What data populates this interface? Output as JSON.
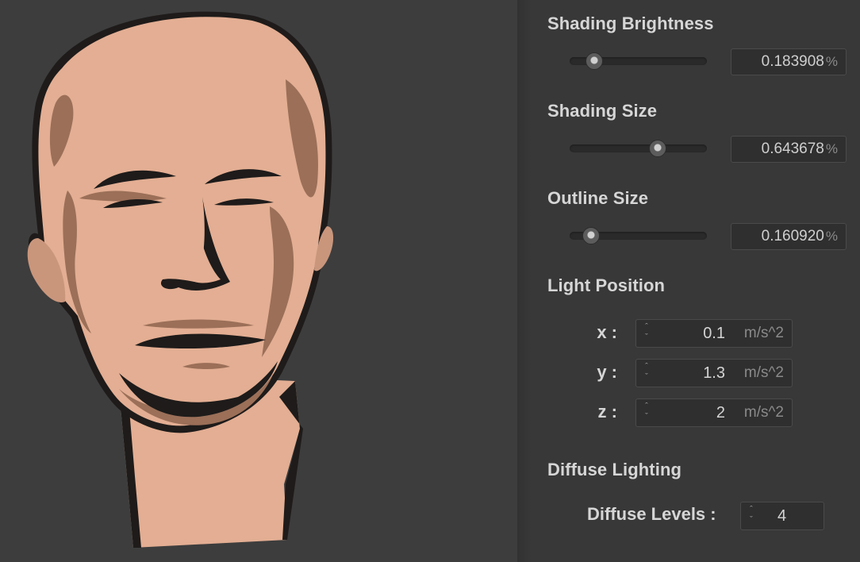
{
  "viewport": {
    "model": "head-sculpture",
    "colors": {
      "background": "#3d3d3d",
      "skin": "#e3ae93",
      "shade": "#9b6f58",
      "outline": "#1e1b1a"
    }
  },
  "panel": {
    "shading_brightness": {
      "title": "Shading Brightness",
      "value": "0.183908",
      "unit": "%",
      "level": 0.18
    },
    "shading_size": {
      "title": "Shading Size",
      "value": "0.643678",
      "unit": "%",
      "level": 0.64
    },
    "outline_size": {
      "title": "Outline Size",
      "value": "0.160920",
      "unit": "%",
      "level": 0.16
    },
    "light_position": {
      "title": "Light Position",
      "x": {
        "label": "x :",
        "value": "0.1",
        "unit": "m/s^2"
      },
      "y": {
        "label": "y :",
        "value": "1.3",
        "unit": "m/s^2"
      },
      "z": {
        "label": "z :",
        "value": "2",
        "unit": "m/s^2"
      }
    },
    "diffuse_lighting": {
      "title": "Diffuse Lighting",
      "levels_label": "Diffuse Levels :",
      "levels_value": "4"
    },
    "icons": {
      "spinner": "spinner-arrows-icon"
    }
  }
}
